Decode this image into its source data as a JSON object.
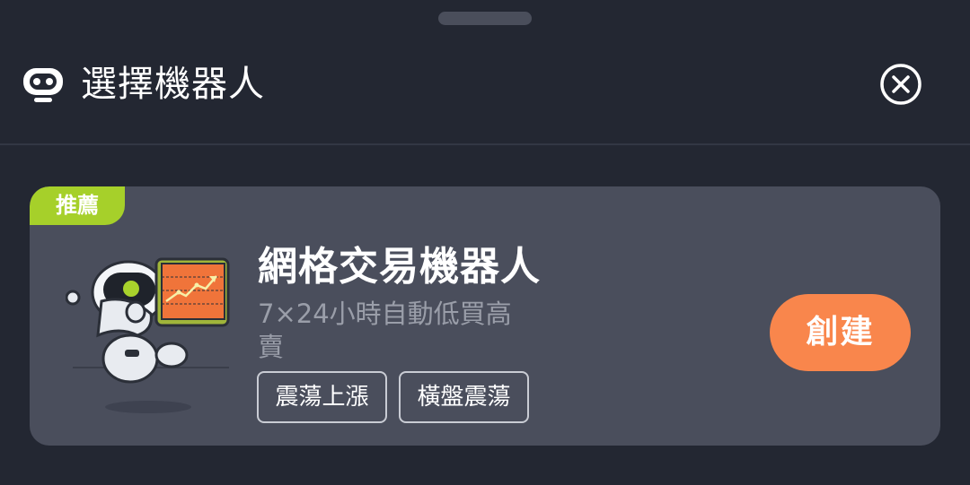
{
  "header": {
    "title": "選擇機器人",
    "icon": "robot-icon",
    "close_icon": "close-circle-icon"
  },
  "card": {
    "badge": "推薦",
    "title": "網格交易機器人",
    "description": "7×24小時自動低買高賣",
    "tags": [
      "震蕩上漲",
      "橫盤震蕩"
    ],
    "create_label": "創建",
    "illustration": "robot-with-chart-illustration"
  },
  "colors": {
    "background": "#232732",
    "card": "#4a4e5c",
    "badge": "#a6d02a",
    "accent": "#f9864c",
    "secondary_text": "#9a9ea9"
  }
}
